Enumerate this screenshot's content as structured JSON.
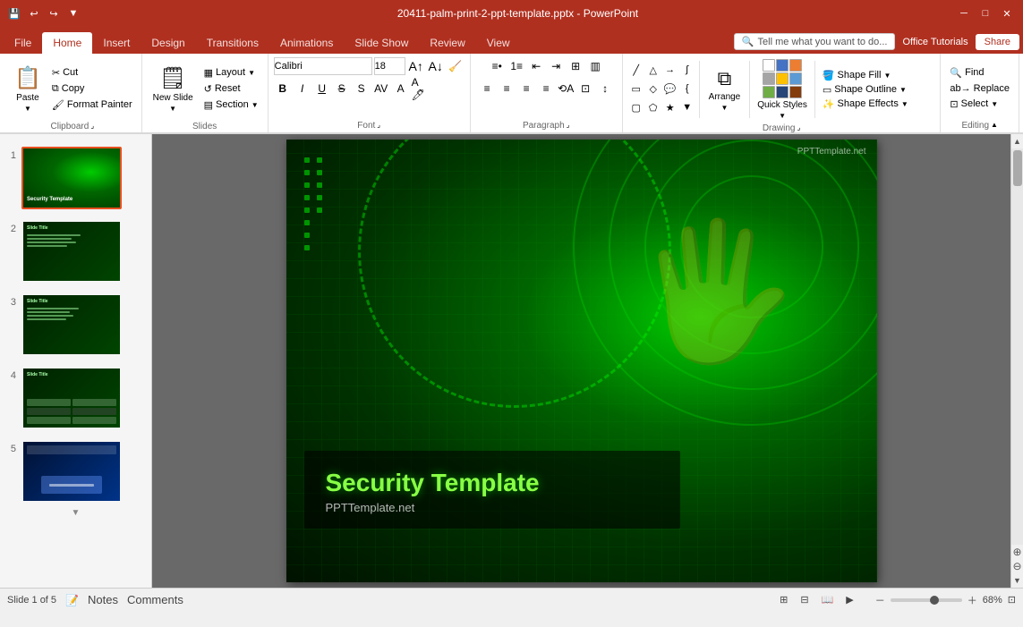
{
  "titlebar": {
    "filename": "20411-palm-print-2-ppt-template.pptx - PowerPoint",
    "window_controls": [
      "minimize",
      "maximize",
      "close"
    ]
  },
  "tabs": [
    {
      "label": "File",
      "active": false
    },
    {
      "label": "Home",
      "active": true
    },
    {
      "label": "Insert",
      "active": false
    },
    {
      "label": "Design",
      "active": false
    },
    {
      "label": "Transitions",
      "active": false
    },
    {
      "label": "Animations",
      "active": false
    },
    {
      "label": "Slide Show",
      "active": false
    },
    {
      "label": "Review",
      "active": false
    },
    {
      "label": "View",
      "active": false
    }
  ],
  "search_placeholder": "Tell me what you want to do...",
  "office_tutorials": "Office Tutorials",
  "share_label": "Share",
  "ribbon": {
    "clipboard": {
      "label": "Clipboard",
      "paste": "Paste",
      "cut": "Cut",
      "copy": "Copy",
      "format_painter": "Format Painter"
    },
    "slides": {
      "label": "Slides",
      "new_slide": "New Slide",
      "layout": "Layout",
      "reset": "Reset",
      "section": "Section"
    },
    "font": {
      "label": "Font",
      "font_name": "Calibri",
      "font_size": "18"
    },
    "paragraph": {
      "label": "Paragraph"
    },
    "drawing": {
      "label": "Drawing",
      "arrange": "Arrange",
      "quick_styles": "Quick Styles",
      "shape_fill": "Shape Fill",
      "shape_outline": "Shape Outline",
      "shape_effects": "Shape Effects"
    },
    "editing": {
      "label": "Editing",
      "find": "Find",
      "replace": "Replace",
      "select": "Select"
    }
  },
  "slides": [
    {
      "num": 1,
      "type": "security",
      "active": true
    },
    {
      "num": 2,
      "type": "content",
      "active": false
    },
    {
      "num": 3,
      "type": "content",
      "active": false
    },
    {
      "num": 4,
      "type": "table",
      "active": false
    },
    {
      "num": 5,
      "type": "blue",
      "active": false
    }
  ],
  "current_slide": {
    "title": "Security Template",
    "subtitle": "PPTTemplate.net",
    "watermark": "PPTTemplate.net"
  },
  "statusbar": {
    "slide_info": "Slide 1 of 5",
    "notes": "Notes",
    "comments": "Comments",
    "zoom": "68%"
  }
}
